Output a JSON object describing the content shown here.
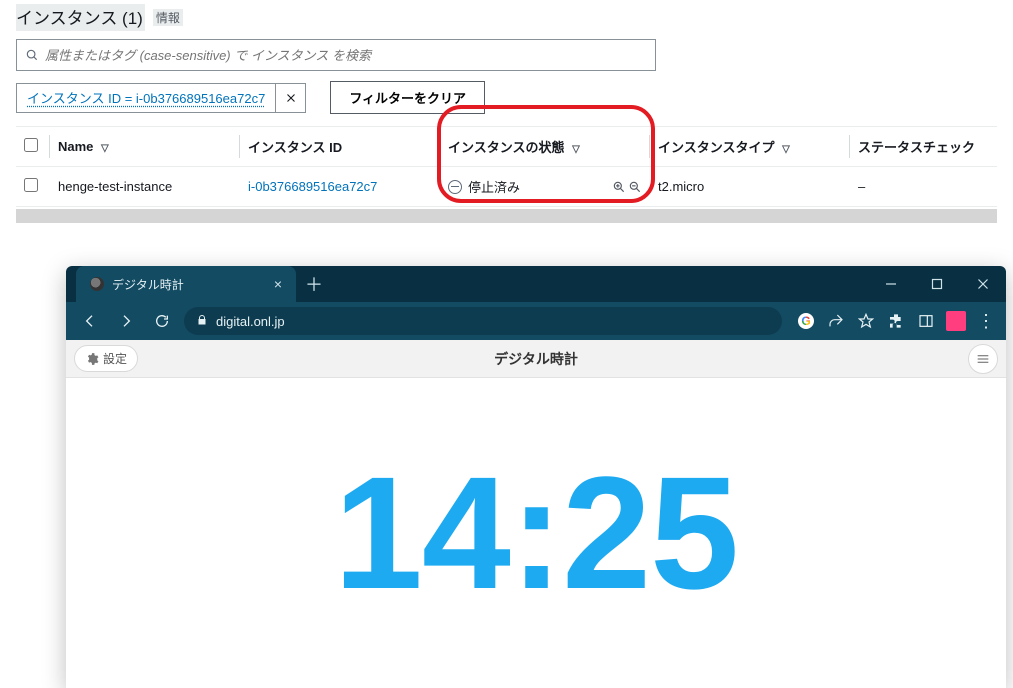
{
  "aws": {
    "header": {
      "title": "インスタンス (1)",
      "info": "情報"
    },
    "search": {
      "placeholder": "属性またはタグ (case-sensitive) で インスタンス を検索"
    },
    "filter_chip": "インスタンス ID = i-0b376689516ea72c7",
    "clear_filters": "フィルターをクリア",
    "columns": {
      "name": "Name",
      "instance_id": "インスタンス ID",
      "state": "インスタンスの状態",
      "type": "インスタンスタイプ",
      "status_check": "ステータスチェック"
    },
    "rows": [
      {
        "name": "henge-test-instance",
        "instance_id": "i-0b376689516ea72c7",
        "state": "停止済み",
        "type": "t2.micro",
        "status_check": "–"
      }
    ]
  },
  "browser": {
    "tab_title": "デジタル時計",
    "url": "digital.onl.jp",
    "settings_label": "設定",
    "page_title": "デジタル時計",
    "clock": "14:25"
  }
}
